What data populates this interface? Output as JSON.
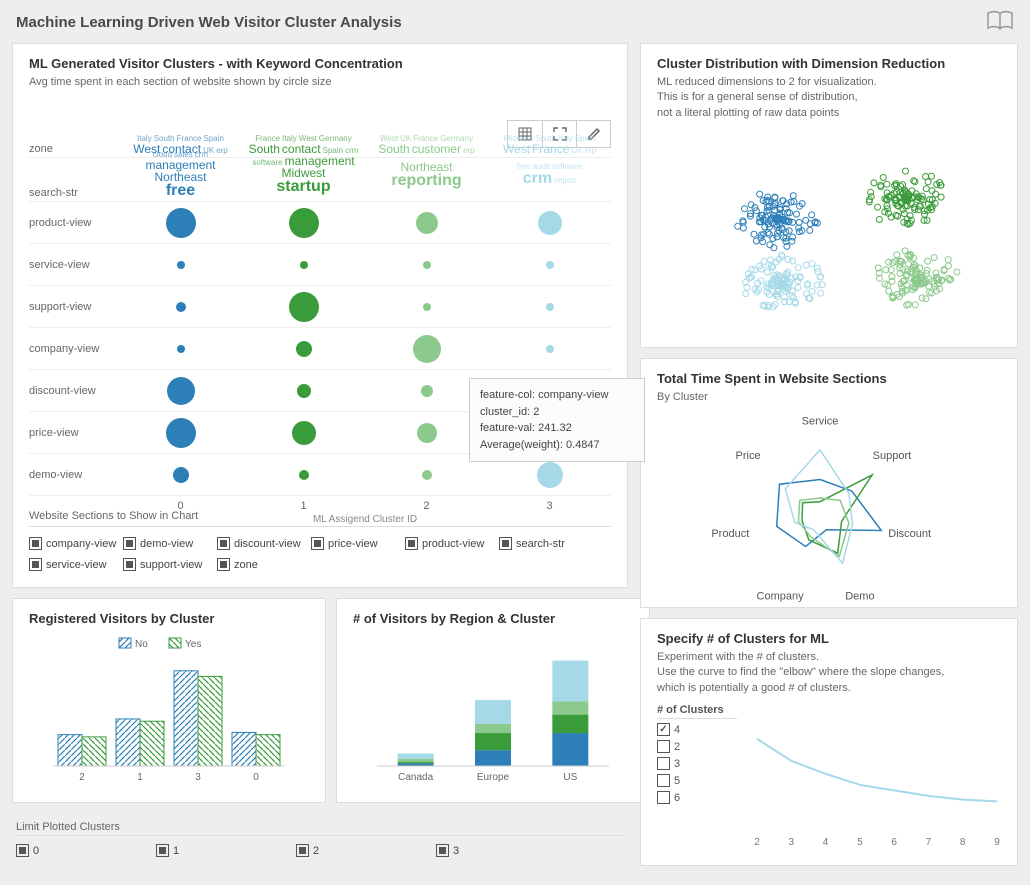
{
  "page_title": "Machine Learning Driven Web Visitor Cluster Analysis",
  "bubble": {
    "title": "ML Generated Visitor Clusters - with Keyword Concentration",
    "subtitle": "Avg time spent in each section of website shown by circle size",
    "xaxis_title": "ML Assigend Cluster ID",
    "rows": [
      "zone",
      "search-str",
      "product-view",
      "service-view",
      "support-view",
      "company-view",
      "discount-view",
      "price-view",
      "demo-view"
    ],
    "clusters": [
      "0",
      "1",
      "2",
      "3"
    ],
    "filter_title": "Website Sections to Show in Chart",
    "filter_items": [
      "company-view",
      "demo-view",
      "discount-view",
      "price-view",
      "product-view",
      "search-str",
      "service-view",
      "support-view",
      "zone"
    ]
  },
  "tooltip": {
    "l1": "feature-col: company-view",
    "l2": "cluster_id: 2",
    "l3": "feature-val: 241.32",
    "l4": "Average(weight): 0.4847"
  },
  "wordclouds": {
    "c0": {
      "big": "free",
      "med": [
        "West",
        "contact",
        "management",
        "Northeast"
      ],
      "sm": [
        "Italy",
        "South",
        "France",
        "Spain",
        "UK",
        "erp",
        "cloud",
        "sales",
        "crm"
      ]
    },
    "c1": {
      "big": "startup",
      "med": [
        "South",
        "contact",
        "management",
        "Midwest"
      ],
      "sm": [
        "France",
        "Italy",
        "West",
        "Germany",
        "Spain",
        "crm",
        "software"
      ]
    },
    "c2": {
      "big": "reporting",
      "med": [
        "South",
        "customer",
        "Northeast"
      ],
      "sm": [
        "West",
        "UK",
        "France",
        "Germany",
        "erp"
      ]
    },
    "c3": {
      "big": "crm",
      "med": [
        "West",
        "France"
      ],
      "sm": [
        "Midwest",
        "South",
        "Italy",
        "Spain",
        "UK",
        "erp",
        "free",
        "audit",
        "software",
        "import"
      ]
    }
  },
  "reg": {
    "title": "Registered Visitors by Cluster",
    "legend": [
      "No",
      "Yes"
    ]
  },
  "region": {
    "title": "# of Visitors by Region & Cluster"
  },
  "limit": {
    "title": "Limit Plotted Clusters",
    "items": [
      "0",
      "1",
      "2",
      "3"
    ]
  },
  "scatter": {
    "title": "Cluster Distribution with Dimension Reduction",
    "sub": "ML reduced dimensions to 2 for visualization.\nThis is for a general sense of distribution,\nnot a literal plotting of raw data points"
  },
  "radar": {
    "title": "Total Time Spent in Website Sections",
    "sub": "By Cluster",
    "axes": [
      "Service",
      "Support",
      "Discount",
      "Demo",
      "Company",
      "Product",
      "Price"
    ]
  },
  "elbow": {
    "title": "Specify # of Clusters for ML",
    "sub": "Experiment with the # of clusters.\nUse the curve to find the \"elbow\" where the slope changes,\nwhich is potentially a good # of clusters.",
    "check_title": "# of Clusters",
    "checks": [
      "4",
      "2",
      "3",
      "5",
      "6"
    ]
  },
  "chart_data": [
    {
      "type": "scatter",
      "name": "bubble-matrix",
      "title": "ML Generated Visitor Clusters - with Keyword Concentration",
      "xlabel": "ML Assigend Cluster ID",
      "y_categories": [
        "product-view",
        "service-view",
        "support-view",
        "company-view",
        "discount-view",
        "price-view",
        "demo-view"
      ],
      "x_categories": [
        "0",
        "1",
        "2",
        "3"
      ],
      "size_matrix": [
        [
          30,
          30,
          22,
          24
        ],
        [
          8,
          8,
          8,
          8
        ],
        [
          10,
          30,
          8,
          8
        ],
        [
          8,
          16,
          28,
          8
        ],
        [
          28,
          14,
          12,
          8
        ],
        [
          30,
          24,
          20,
          8
        ],
        [
          16,
          10,
          10,
          26
        ]
      ]
    },
    {
      "type": "bar",
      "name": "registered-visitors",
      "title": "Registered Visitors by Cluster",
      "categories": [
        "2",
        "1",
        "3",
        "0"
      ],
      "series": [
        {
          "name": "No",
          "values": [
            28,
            42,
            85,
            30
          ]
        },
        {
          "name": "Yes",
          "values": [
            26,
            40,
            80,
            28
          ]
        }
      ],
      "ylim": [
        0,
        100
      ]
    },
    {
      "type": "bar",
      "name": "visitors-by-region",
      "title": "# of Visitors by Region & Cluster",
      "stacked": true,
      "categories": [
        "Canada",
        "Europe",
        "US"
      ],
      "series": [
        {
          "name": "0",
          "values": [
            4,
            24,
            50
          ]
        },
        {
          "name": "1",
          "values": [
            2,
            26,
            28
          ]
        },
        {
          "name": "2",
          "values": [
            5,
            14,
            20
          ]
        },
        {
          "name": "3",
          "values": [
            8,
            36,
            62
          ]
        }
      ],
      "ylim": [
        0,
        170
      ]
    },
    {
      "type": "scatter",
      "name": "dimension-reduction",
      "title": "Cluster Distribution with Dimension Reduction",
      "series": [
        {
          "name": "0",
          "color": "#2d7fb8"
        },
        {
          "name": "1",
          "color": "#3a9b3a"
        },
        {
          "name": "2",
          "color": "#8cc98c"
        },
        {
          "name": "3",
          "color": "#a6d9e8"
        }
      ]
    },
    {
      "type": "line",
      "name": "radar",
      "title": "Total Time Spent in Website Sections",
      "axes": [
        "Service",
        "Support",
        "Discount",
        "Demo",
        "Company",
        "Product",
        "Price"
      ],
      "series": [
        {
          "name": "0",
          "color": "#2d7fb8",
          "values": [
            0.5,
            0.55,
            0.85,
            0.2,
            0.45,
            0.6,
            0.7
          ]
        },
        {
          "name": "1",
          "color": "#3a9b3a",
          "values": [
            0.2,
            0.9,
            0.3,
            0.55,
            0.35,
            0.25,
            0.3
          ]
        },
        {
          "name": "2",
          "color": "#8cc98c",
          "values": [
            0.25,
            0.35,
            0.4,
            0.6,
            0.3,
            0.3,
            0.35
          ]
        },
        {
          "name": "3",
          "color": "#a6d9e8",
          "values": [
            0.9,
            0.5,
            0.45,
            0.7,
            0.2,
            0.35,
            0.6
          ]
        }
      ]
    },
    {
      "type": "line",
      "name": "elbow",
      "title": "Specify # of Clusters for ML",
      "x": [
        2,
        3,
        4,
        5,
        6,
        7,
        8,
        9
      ],
      "values": [
        98,
        74,
        60,
        48,
        42,
        36,
        32,
        30
      ],
      "ylim": [
        0,
        100
      ]
    }
  ]
}
